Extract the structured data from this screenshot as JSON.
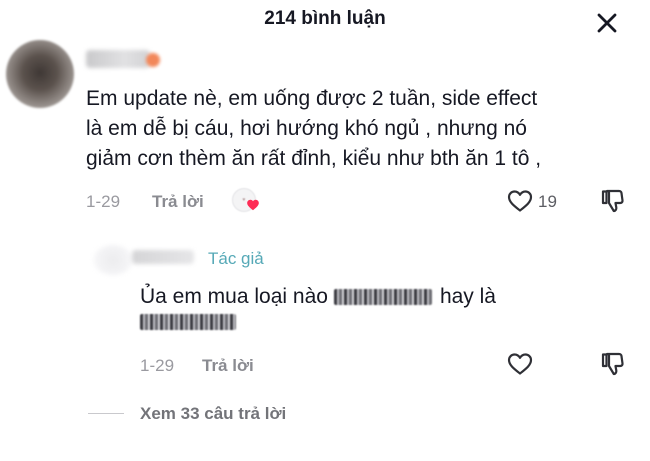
{
  "header": {
    "title": "214 bình luận",
    "close_icon": "close-icon"
  },
  "comment": {
    "lines": [
      "Em update nè, em uống được 2 tuần, side effect",
      "là em dễ bị cáu, hơi hướng khó ngủ , nhưng nó",
      "giảm cơn thèm ăn rất đỉnh, kiểu như bth ăn 1 tô ,"
    ],
    "date": "1-29",
    "reply_label": "Trả lời",
    "likes": "19",
    "creator_liked": true
  },
  "reply": {
    "author_tag": "Tác giả",
    "text_start": "Ủa em mua loại nào",
    "text_mid": "hay là",
    "date": "1-29",
    "reply_label": "Trả lời"
  },
  "view_replies": "Xem 33 câu trả lời",
  "colors": {
    "text": "#161823",
    "muted": "#8a8b91",
    "author_tag": "#56a9b7",
    "heart": "#fe2c55"
  }
}
